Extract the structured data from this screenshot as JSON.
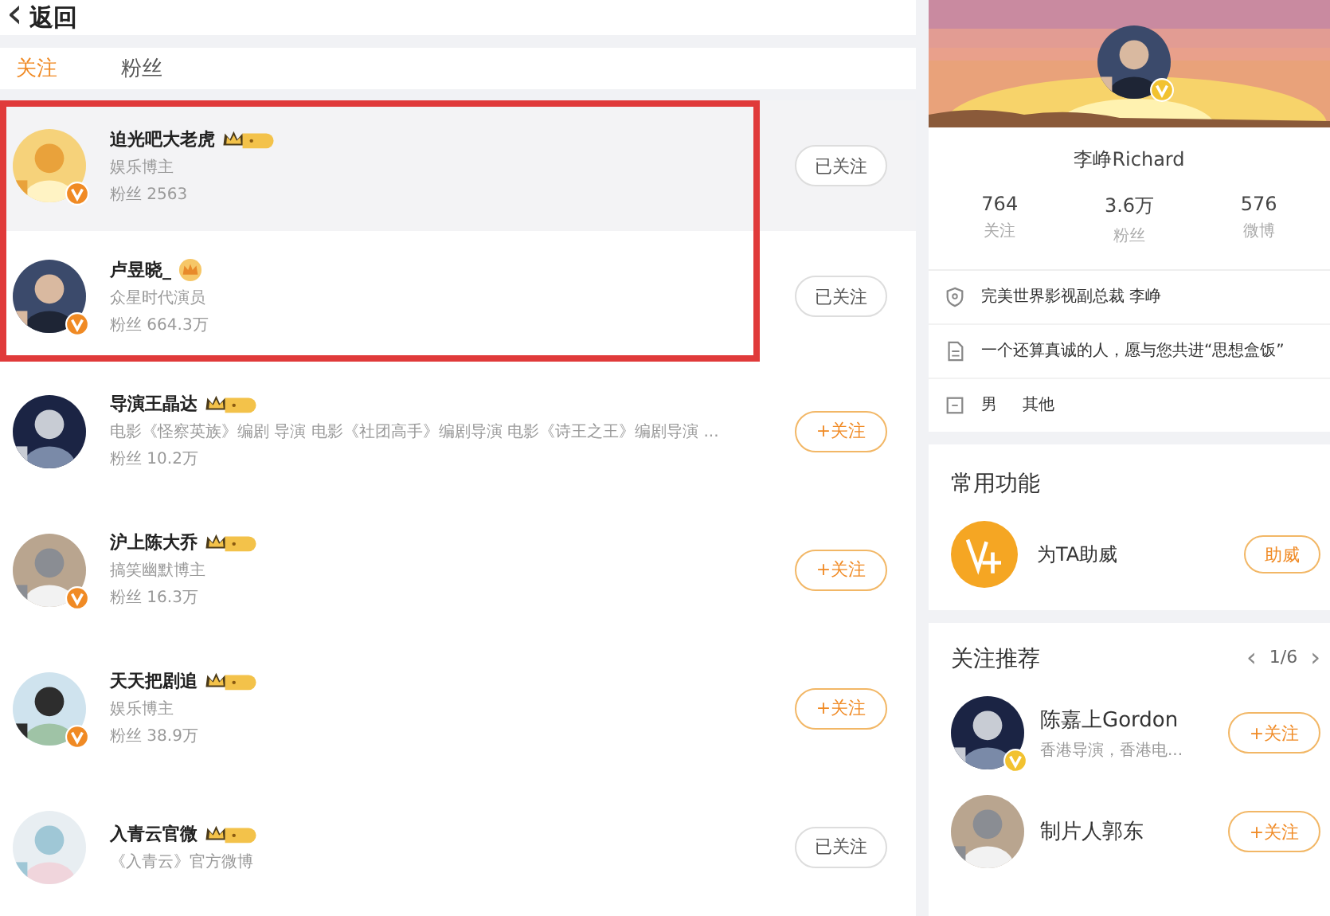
{
  "header": {
    "back_icon": "‹",
    "back_label": "返回"
  },
  "tabs": [
    {
      "label": "关注",
      "selected": true
    },
    {
      "label": "粉丝",
      "selected": false
    }
  ],
  "users": [
    {
      "name": "迫光吧大老虎",
      "kind": "crown-pill",
      "verified": true,
      "desc": "娱乐博主",
      "fans": "粉丝 2563",
      "button": "已关注",
      "followed": true,
      "hovered": true,
      "outlined": true
    },
    {
      "name": "卢昱晓_",
      "kind": "crown",
      "verified": true,
      "desc": "众星时代演员",
      "fans": "粉丝 664.3万",
      "button": "已关注",
      "followed": true,
      "hovered": false,
      "outlined": true
    },
    {
      "name": "导演王晶达",
      "kind": "crown-pill",
      "verified": false,
      "desc": "电影《怪察英族》编剧 导演 电影《社团高手》编剧导演 电影《诗王之王》编剧导演 ...",
      "fans": "粉丝 10.2万",
      "button": "+关注",
      "followed": false,
      "hovered": false,
      "outlined": false
    },
    {
      "name": "沪上陈大乔",
      "kind": "crown-pill",
      "verified": true,
      "desc": "搞笑幽默博主",
      "fans": "粉丝 16.3万",
      "button": "+关注",
      "followed": false,
      "hovered": false,
      "outlined": false
    },
    {
      "name": "天天把剧追",
      "kind": "crown-pill",
      "verified": true,
      "desc": "娱乐博主",
      "fans": "粉丝 38.9万",
      "button": "+关注",
      "followed": false,
      "hovered": false,
      "outlined": false
    },
    {
      "name": "入青云官微",
      "kind": "crown-pill",
      "verified": false,
      "desc": "《入青云》官方微博",
      "button": "已关注",
      "followed": true,
      "hovered": false,
      "outlined": false
    }
  ],
  "profile": {
    "name": "李峥Richard",
    "stats": [
      {
        "value": "764",
        "label": "关注"
      },
      {
        "value": "3.6万",
        "label": "粉丝"
      },
      {
        "value": "576",
        "label": "微博"
      }
    ],
    "info": [
      {
        "kind": "badge",
        "text": "完美世界影视副总裁 李峥"
      },
      {
        "kind": "bio",
        "text": "一个还算真诚的人，愿与您共进“思想盒饭”"
      },
      {
        "kind": "basic",
        "text": "男",
        "extra": "其他"
      }
    ]
  },
  "functions": {
    "title": "常用功能",
    "items": [
      {
        "label": "为TA助威",
        "button": "助威"
      }
    ]
  },
  "recommend": {
    "title": "关注推荐",
    "prev": "‹",
    "page": "1/6",
    "next": "›",
    "users": [
      {
        "name": "陈嘉上Gordon",
        "desc": "香港导演，香港电...",
        "button": "+关注",
        "verified": true
      },
      {
        "name": "制片人郭东",
        "button": "+关注",
        "verified": false
      }
    ]
  }
}
